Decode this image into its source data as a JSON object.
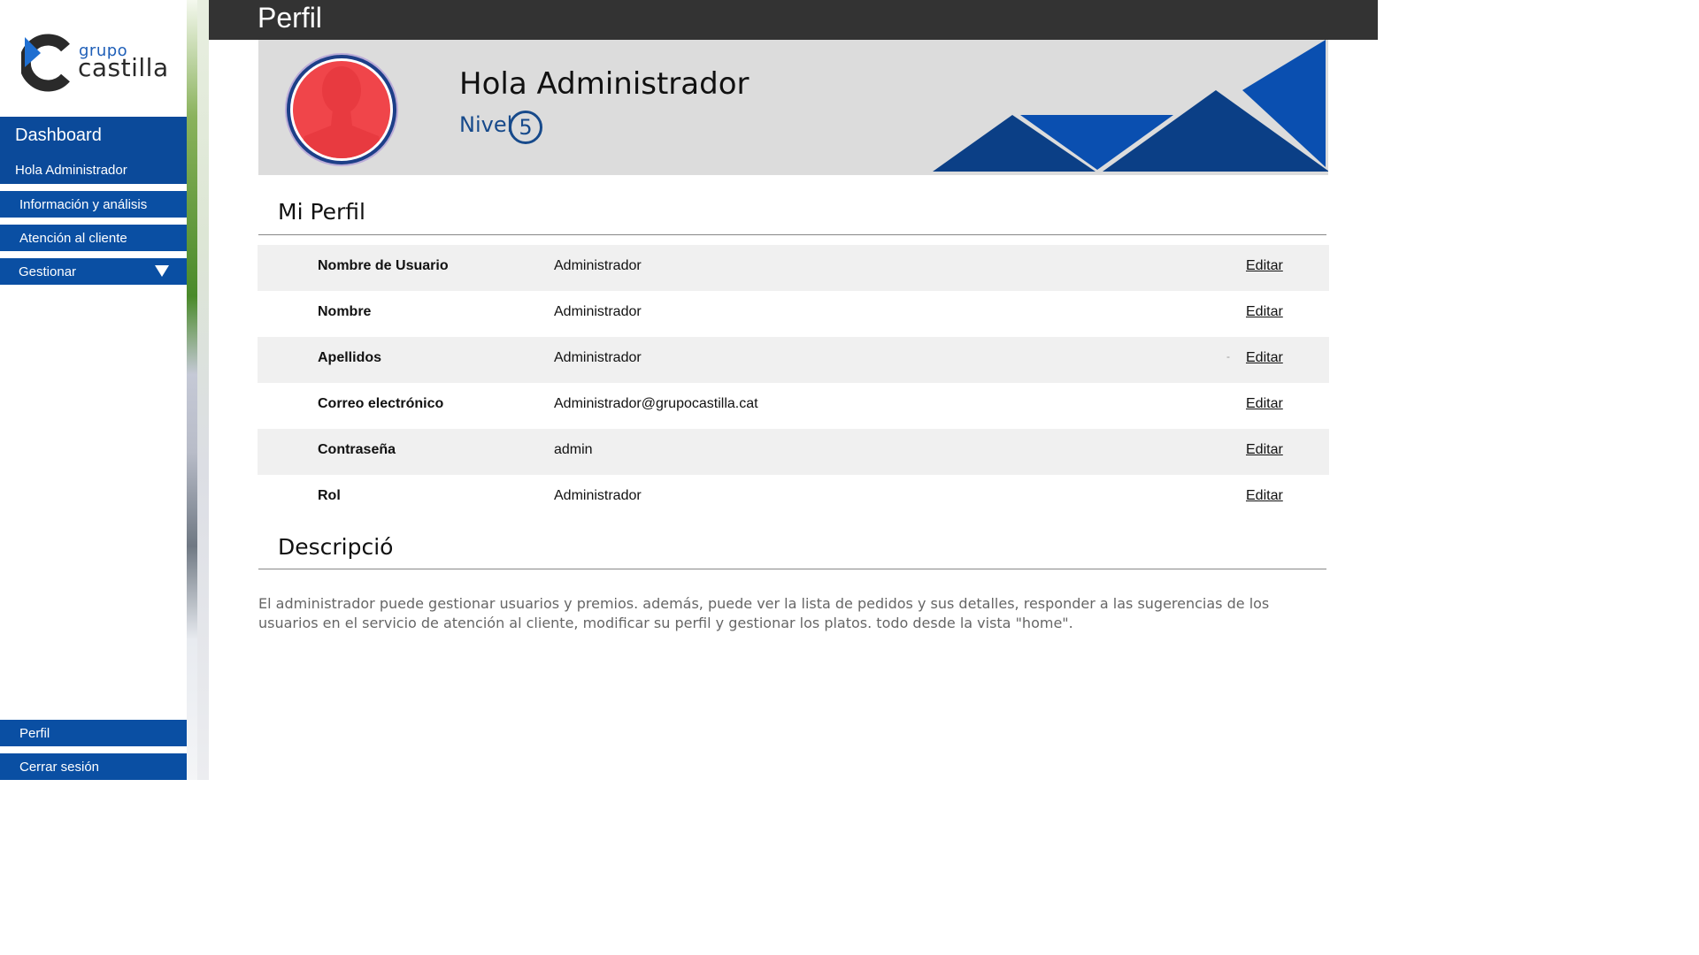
{
  "sidebar": {
    "logo": {
      "line1": "grupo",
      "line2": "castilla"
    },
    "dashboard_label": "Dashboard",
    "greeting": "Hola Administrador",
    "items": [
      {
        "label": "Información y análisis"
      },
      {
        "label": "Atención al cliente"
      },
      {
        "label": "Gestionar"
      }
    ],
    "bottom_items": [
      {
        "label": "Perfil"
      },
      {
        "label": "Cerrar sesión"
      }
    ]
  },
  "header": {
    "title": "Perfil"
  },
  "banner": {
    "greeting": "Hola Administrador",
    "level_label": "Nivel",
    "level_value": "5"
  },
  "profile": {
    "section_title": "Mi Perfil",
    "edit_label": "Editar",
    "rows": [
      {
        "field": "Nombre de Usuario",
        "value": "Administrador"
      },
      {
        "field": "Nombre",
        "value": "Administrador"
      },
      {
        "field": "Apellidos",
        "value": "Administrador"
      },
      {
        "field": "Correo electrónico",
        "value": "Administrador@grupocastilla.cat"
      },
      {
        "field": "Contraseña",
        "value": "admin"
      },
      {
        "field": "Rol",
        "value": "Administrador"
      }
    ]
  },
  "description": {
    "section_title": "Descripció",
    "text": "El administrador puede gestionar usuarios y premios. además, puede ver la lista de pedidos y sus detalles, responder a las sugerencias de los usuarios en el servicio de atención al cliente, modificar su perfil  y gestionar los platos. todo desde la vista \"home\"."
  },
  "colors": {
    "nav_blue": "#0a4fa3",
    "header_dark": "#333333",
    "accent_navy": "#174a8b",
    "avatar_red": "#f0454a"
  }
}
